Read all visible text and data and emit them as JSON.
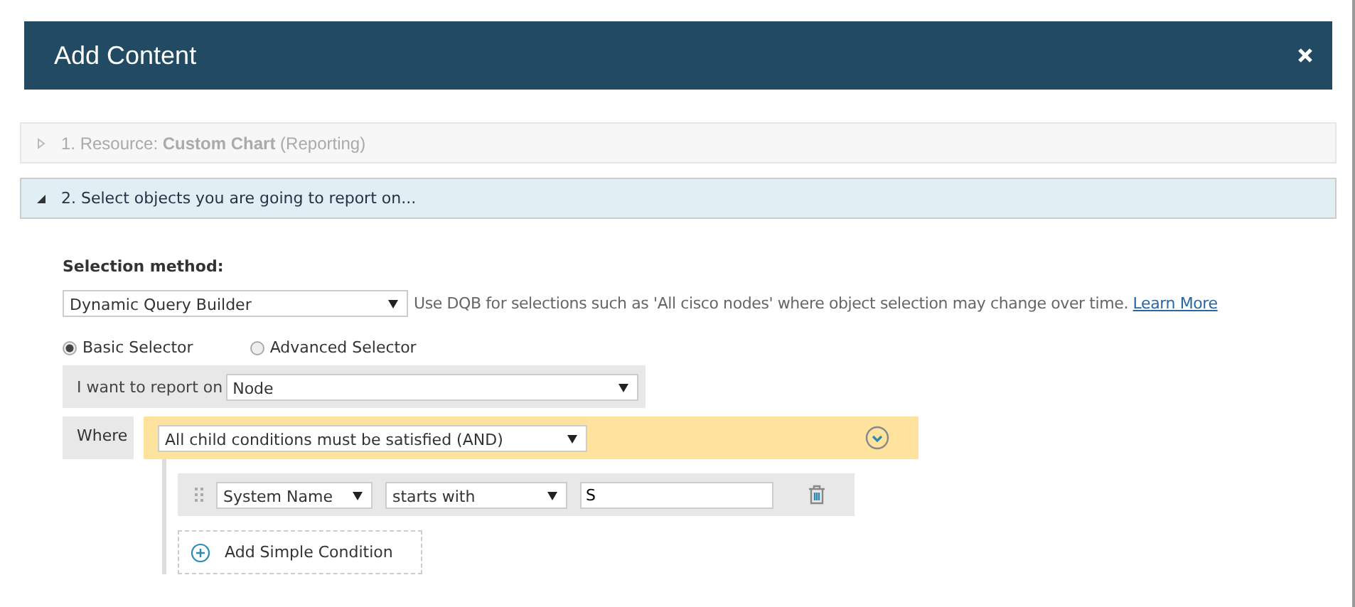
{
  "window": {
    "title": "Add Content"
  },
  "steps": [
    {
      "label": "1. Resource: **Custom Chart** (Reporting)",
      "expanded": false,
      "disabled": true
    },
    {
      "label": "2. Select objects you are going to report on...",
      "expanded": true,
      "disabled": false
    }
  ],
  "selection_method": {
    "label": "Selection method:",
    "value": "Dynamic Query Builder",
    "hint": "Use DQB for selections such as 'All cisco nodes' where object selection may change over time.",
    "link": "Learn More"
  },
  "selectors": [
    {
      "label": "Basic Selector",
      "selected": true
    },
    {
      "label": "Advanced Selector",
      "selected": false
    }
  ],
  "report_on": {
    "label": "I want to report on",
    "value": "Node"
  },
  "where": {
    "label": "Where",
    "group_value": "All child conditions must be satisfied (AND)",
    "conditions": [
      {
        "field": "System Name",
        "operator": "starts with",
        "value": "S"
      }
    ],
    "add_label": "Add Simple Condition"
  }
}
